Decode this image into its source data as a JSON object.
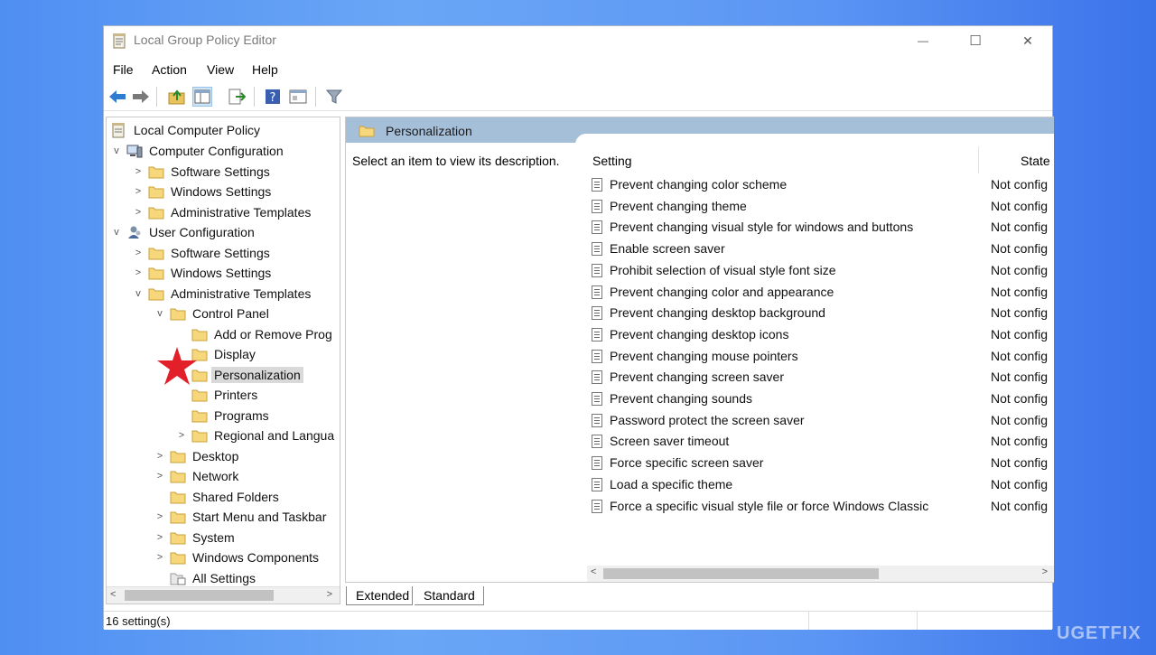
{
  "window": {
    "title": "Local Group Policy Editor",
    "controls": {
      "minimize": "—",
      "maximize": "☐",
      "close": "✕"
    }
  },
  "menu": [
    "File",
    "Action",
    "View",
    "Help"
  ],
  "toolbar": {
    "icons": [
      "back-icon",
      "forward-icon",
      "up-folder-icon",
      "show-hide-tree-icon",
      "export-list-icon",
      "help-icon",
      "properties-icon",
      "filter-icon"
    ]
  },
  "tree": {
    "root": "Local Computer Policy",
    "items": [
      {
        "label": "Computer Configuration",
        "level": 1,
        "expander": "v",
        "icon": "computer-icon"
      },
      {
        "label": "Software Settings",
        "level": 2,
        "expander": ">",
        "icon": "folder-icon"
      },
      {
        "label": "Windows Settings",
        "level": 2,
        "expander": ">",
        "icon": "folder-icon"
      },
      {
        "label": "Administrative Templates",
        "level": 2,
        "expander": ">",
        "icon": "folder-icon"
      },
      {
        "label": "User Configuration",
        "level": 1,
        "expander": "v",
        "icon": "user-icon"
      },
      {
        "label": "Software Settings",
        "level": 2,
        "expander": ">",
        "icon": "folder-icon"
      },
      {
        "label": "Windows Settings",
        "level": 2,
        "expander": ">",
        "icon": "folder-icon"
      },
      {
        "label": "Administrative Templates",
        "level": 2,
        "expander": "v",
        "icon": "folder-icon"
      },
      {
        "label": "Control Panel",
        "level": 3,
        "expander": "v",
        "icon": "folder-icon"
      },
      {
        "label": "Add or Remove Prog",
        "level": 4,
        "expander": "",
        "icon": "folder-icon"
      },
      {
        "label": "Display",
        "level": 4,
        "expander": "",
        "icon": "folder-icon"
      },
      {
        "label": "Personalization",
        "level": 4,
        "expander": "",
        "icon": "folder-icon",
        "selected": true
      },
      {
        "label": "Printers",
        "level": 4,
        "expander": "",
        "icon": "folder-icon"
      },
      {
        "label": "Programs",
        "level": 4,
        "expander": "",
        "icon": "folder-icon"
      },
      {
        "label": "Regional and Langua",
        "level": 4,
        "expander": ">",
        "icon": "folder-icon"
      },
      {
        "label": "Desktop",
        "level": 3,
        "expander": ">",
        "icon": "folder-icon"
      },
      {
        "label": "Network",
        "level": 3,
        "expander": ">",
        "icon": "folder-icon"
      },
      {
        "label": "Shared Folders",
        "level": 3,
        "expander": "",
        "icon": "folder-icon"
      },
      {
        "label": "Start Menu and Taskbar",
        "level": 3,
        "expander": ">",
        "icon": "folder-icon"
      },
      {
        "label": "System",
        "level": 3,
        "expander": ">",
        "icon": "folder-icon"
      },
      {
        "label": "Windows Components",
        "level": 3,
        "expander": ">",
        "icon": "folder-icon"
      },
      {
        "label": "All Settings",
        "level": 3,
        "expander": "",
        "icon": "all-settings-icon"
      }
    ]
  },
  "details": {
    "header": "Personalization",
    "description": "Select an item to view its description.",
    "columns": {
      "setting": "Setting",
      "state": "State"
    },
    "rows": [
      {
        "setting": "Prevent changing color scheme",
        "state": "Not config"
      },
      {
        "setting": "Prevent changing theme",
        "state": "Not config"
      },
      {
        "setting": "Prevent changing visual style for windows and buttons",
        "state": "Not config"
      },
      {
        "setting": "Enable screen saver",
        "state": "Not config"
      },
      {
        "setting": "Prohibit selection of visual style font size",
        "state": "Not config"
      },
      {
        "setting": "Prevent changing color and appearance",
        "state": "Not config"
      },
      {
        "setting": "Prevent changing desktop background",
        "state": "Not config"
      },
      {
        "setting": "Prevent changing desktop icons",
        "state": "Not config"
      },
      {
        "setting": "Prevent changing mouse pointers",
        "state": "Not config"
      },
      {
        "setting": "Prevent changing screen saver",
        "state": "Not config"
      },
      {
        "setting": "Prevent changing sounds",
        "state": "Not config"
      },
      {
        "setting": "Password protect the screen saver",
        "state": "Not config"
      },
      {
        "setting": "Screen saver timeout",
        "state": "Not config"
      },
      {
        "setting": "Force specific screen saver",
        "state": "Not config"
      },
      {
        "setting": "Load a specific theme",
        "state": "Not config"
      },
      {
        "setting": "Force a specific visual style file or force Windows Classic",
        "state": "Not config"
      }
    ]
  },
  "tabs": [
    "Extended",
    "Standard"
  ],
  "status": "16 setting(s)",
  "watermark": "UGETFIX",
  "colors": {
    "accent_star": "#e3202a",
    "pane_header": "#a6bfd9",
    "selection": "#d9d9d9"
  }
}
